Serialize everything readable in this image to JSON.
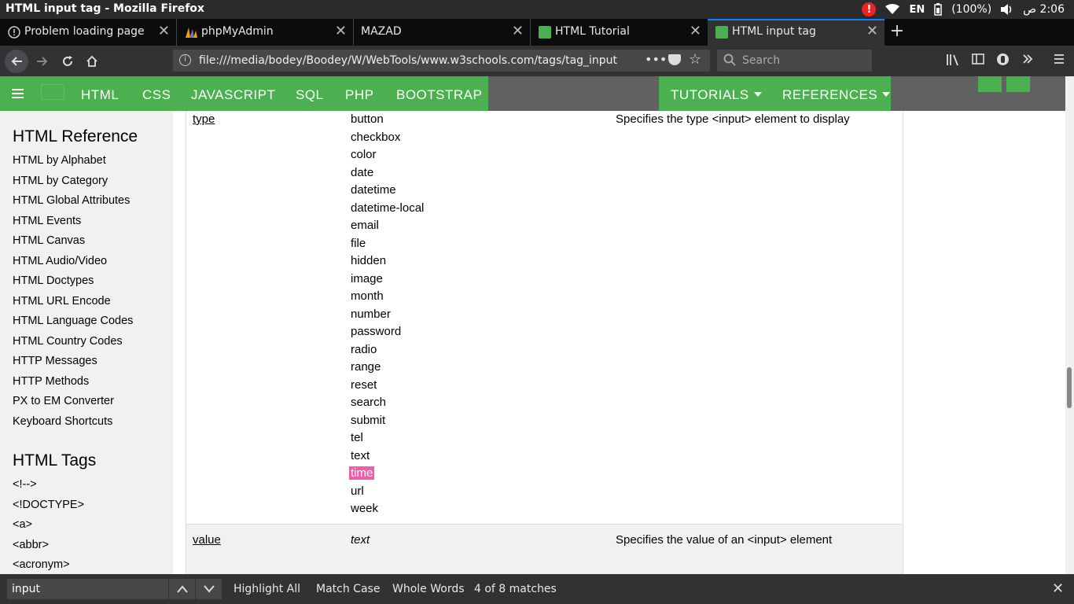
{
  "window": {
    "title": "HTML input tag - Mozilla Firefox"
  },
  "tray": {
    "lang": "EN",
    "battery": "(100%)",
    "clock": "2:06 ص"
  },
  "tabs": [
    {
      "label": "Problem loading page"
    },
    {
      "label": "phpMyAdmin"
    },
    {
      "label": "MAZAD"
    },
    {
      "label": "HTML Tutorial"
    },
    {
      "label": "HTML input tag"
    }
  ],
  "toolbar": {
    "url": "file:///media/bodey/Boodey/W/WebTools/www.w3schools.com/tags/tag_input",
    "search_placeholder": "Search"
  },
  "w3nav": {
    "items": [
      "HTML",
      "CSS",
      "JAVASCRIPT",
      "SQL",
      "PHP",
      "BOOTSTRAP"
    ],
    "tutorials": "TUTORIALS",
    "references": "REFERENCES"
  },
  "sidebar": {
    "heading1": "HTML Reference",
    "links": [
      "HTML by Alphabet",
      "HTML by Category",
      "HTML Global Attributes",
      "HTML Events",
      "HTML Canvas",
      "HTML Audio/Video",
      "HTML Doctypes",
      "HTML URL Encode",
      "HTML Language Codes",
      "HTML Country Codes",
      "HTTP Messages",
      "HTTP Methods",
      "PX to EM Converter",
      "Keyboard Shortcuts"
    ],
    "heading2": "HTML Tags",
    "tags": [
      "<!-->",
      "<!DOCTYPE>",
      "<a>",
      "<abbr>",
      "<acronym>"
    ]
  },
  "table": {
    "row1": {
      "attr": "type",
      "values": [
        "button",
        "checkbox",
        "color",
        "date",
        "datetime",
        "datetime-local",
        "email",
        "file",
        "hidden",
        "image",
        "month",
        "number",
        "password",
        "radio",
        "range",
        "reset",
        "search",
        "submit",
        "tel",
        "text",
        "time",
        "url",
        "week"
      ],
      "description": "Specifies the type <input> element to display"
    },
    "row2": {
      "attr": "value",
      "value": "text",
      "description": "Specifies the value of an <input> element"
    }
  },
  "findbar": {
    "query": "input",
    "highlight_all": "Highlight All",
    "match_case": "Match Case",
    "whole_words": "Whole Words",
    "status": "4 of 8 matches"
  }
}
